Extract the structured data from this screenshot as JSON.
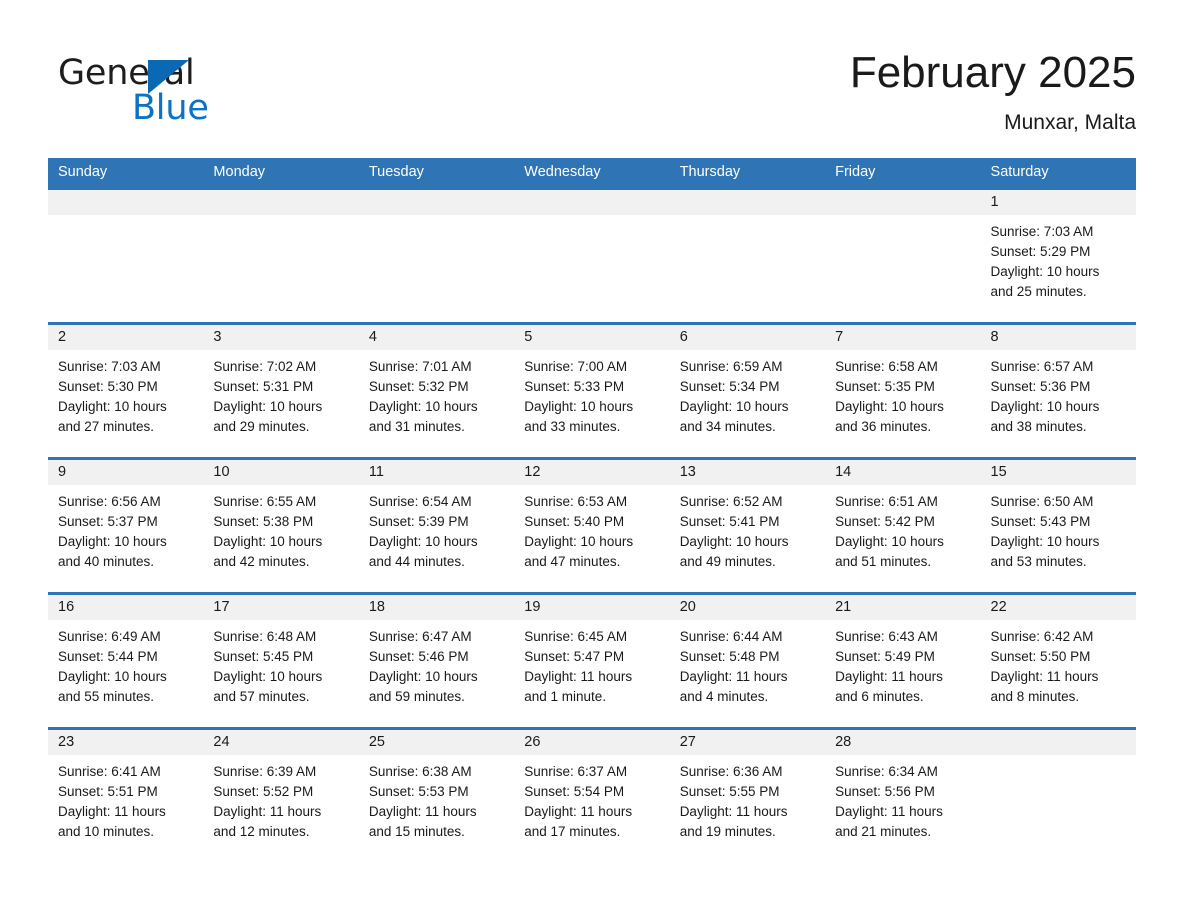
{
  "brand": {
    "name_part1": "General",
    "name_part2": "Blue",
    "triangle_color": "#0b69b4",
    "blue_color": "#0b72c4"
  },
  "header": {
    "month_title": "February 2025",
    "location": "Munxar, Malta"
  },
  "theme": {
    "header_blue": "#2f75b5",
    "daynum_band": "#f1f1f1",
    "text": "#1a1a1a"
  },
  "weekdays": [
    "Sunday",
    "Monday",
    "Tuesday",
    "Wednesday",
    "Thursday",
    "Friday",
    "Saturday"
  ],
  "weeks": [
    [
      {
        "day": "",
        "lines": []
      },
      {
        "day": "",
        "lines": []
      },
      {
        "day": "",
        "lines": []
      },
      {
        "day": "",
        "lines": []
      },
      {
        "day": "",
        "lines": []
      },
      {
        "day": "",
        "lines": []
      },
      {
        "day": "1",
        "lines": [
          "Sunrise: 7:03 AM",
          "Sunset: 5:29 PM",
          "Daylight: 10 hours",
          "and 25 minutes."
        ]
      }
    ],
    [
      {
        "day": "2",
        "lines": [
          "Sunrise: 7:03 AM",
          "Sunset: 5:30 PM",
          "Daylight: 10 hours",
          "and 27 minutes."
        ]
      },
      {
        "day": "3",
        "lines": [
          "Sunrise: 7:02 AM",
          "Sunset: 5:31 PM",
          "Daylight: 10 hours",
          "and 29 minutes."
        ]
      },
      {
        "day": "4",
        "lines": [
          "Sunrise: 7:01 AM",
          "Sunset: 5:32 PM",
          "Daylight: 10 hours",
          "and 31 minutes."
        ]
      },
      {
        "day": "5",
        "lines": [
          "Sunrise: 7:00 AM",
          "Sunset: 5:33 PM",
          "Daylight: 10 hours",
          "and 33 minutes."
        ]
      },
      {
        "day": "6",
        "lines": [
          "Sunrise: 6:59 AM",
          "Sunset: 5:34 PM",
          "Daylight: 10 hours",
          "and 34 minutes."
        ]
      },
      {
        "day": "7",
        "lines": [
          "Sunrise: 6:58 AM",
          "Sunset: 5:35 PM",
          "Daylight: 10 hours",
          "and 36 minutes."
        ]
      },
      {
        "day": "8",
        "lines": [
          "Sunrise: 6:57 AM",
          "Sunset: 5:36 PM",
          "Daylight: 10 hours",
          "and 38 minutes."
        ]
      }
    ],
    [
      {
        "day": "9",
        "lines": [
          "Sunrise: 6:56 AM",
          "Sunset: 5:37 PM",
          "Daylight: 10 hours",
          "and 40 minutes."
        ]
      },
      {
        "day": "10",
        "lines": [
          "Sunrise: 6:55 AM",
          "Sunset: 5:38 PM",
          "Daylight: 10 hours",
          "and 42 minutes."
        ]
      },
      {
        "day": "11",
        "lines": [
          "Sunrise: 6:54 AM",
          "Sunset: 5:39 PM",
          "Daylight: 10 hours",
          "and 44 minutes."
        ]
      },
      {
        "day": "12",
        "lines": [
          "Sunrise: 6:53 AM",
          "Sunset: 5:40 PM",
          "Daylight: 10 hours",
          "and 47 minutes."
        ]
      },
      {
        "day": "13",
        "lines": [
          "Sunrise: 6:52 AM",
          "Sunset: 5:41 PM",
          "Daylight: 10 hours",
          "and 49 minutes."
        ]
      },
      {
        "day": "14",
        "lines": [
          "Sunrise: 6:51 AM",
          "Sunset: 5:42 PM",
          "Daylight: 10 hours",
          "and 51 minutes."
        ]
      },
      {
        "day": "15",
        "lines": [
          "Sunrise: 6:50 AM",
          "Sunset: 5:43 PM",
          "Daylight: 10 hours",
          "and 53 minutes."
        ]
      }
    ],
    [
      {
        "day": "16",
        "lines": [
          "Sunrise: 6:49 AM",
          "Sunset: 5:44 PM",
          "Daylight: 10 hours",
          "and 55 minutes."
        ]
      },
      {
        "day": "17",
        "lines": [
          "Sunrise: 6:48 AM",
          "Sunset: 5:45 PM",
          "Daylight: 10 hours",
          "and 57 minutes."
        ]
      },
      {
        "day": "18",
        "lines": [
          "Sunrise: 6:47 AM",
          "Sunset: 5:46 PM",
          "Daylight: 10 hours",
          "and 59 minutes."
        ]
      },
      {
        "day": "19",
        "lines": [
          "Sunrise: 6:45 AM",
          "Sunset: 5:47 PM",
          "Daylight: 11 hours",
          "and 1 minute."
        ]
      },
      {
        "day": "20",
        "lines": [
          "Sunrise: 6:44 AM",
          "Sunset: 5:48 PM",
          "Daylight: 11 hours",
          "and 4 minutes."
        ]
      },
      {
        "day": "21",
        "lines": [
          "Sunrise: 6:43 AM",
          "Sunset: 5:49 PM",
          "Daylight: 11 hours",
          "and 6 minutes."
        ]
      },
      {
        "day": "22",
        "lines": [
          "Sunrise: 6:42 AM",
          "Sunset: 5:50 PM",
          "Daylight: 11 hours",
          "and 8 minutes."
        ]
      }
    ],
    [
      {
        "day": "23",
        "lines": [
          "Sunrise: 6:41 AM",
          "Sunset: 5:51 PM",
          "Daylight: 11 hours",
          "and 10 minutes."
        ]
      },
      {
        "day": "24",
        "lines": [
          "Sunrise: 6:39 AM",
          "Sunset: 5:52 PM",
          "Daylight: 11 hours",
          "and 12 minutes."
        ]
      },
      {
        "day": "25",
        "lines": [
          "Sunrise: 6:38 AM",
          "Sunset: 5:53 PM",
          "Daylight: 11 hours",
          "and 15 minutes."
        ]
      },
      {
        "day": "26",
        "lines": [
          "Sunrise: 6:37 AM",
          "Sunset: 5:54 PM",
          "Daylight: 11 hours",
          "and 17 minutes."
        ]
      },
      {
        "day": "27",
        "lines": [
          "Sunrise: 6:36 AM",
          "Sunset: 5:55 PM",
          "Daylight: 11 hours",
          "and 19 minutes."
        ]
      },
      {
        "day": "28",
        "lines": [
          "Sunrise: 6:34 AM",
          "Sunset: 5:56 PM",
          "Daylight: 11 hours",
          "and 21 minutes."
        ]
      },
      {
        "day": "",
        "lines": []
      }
    ]
  ]
}
